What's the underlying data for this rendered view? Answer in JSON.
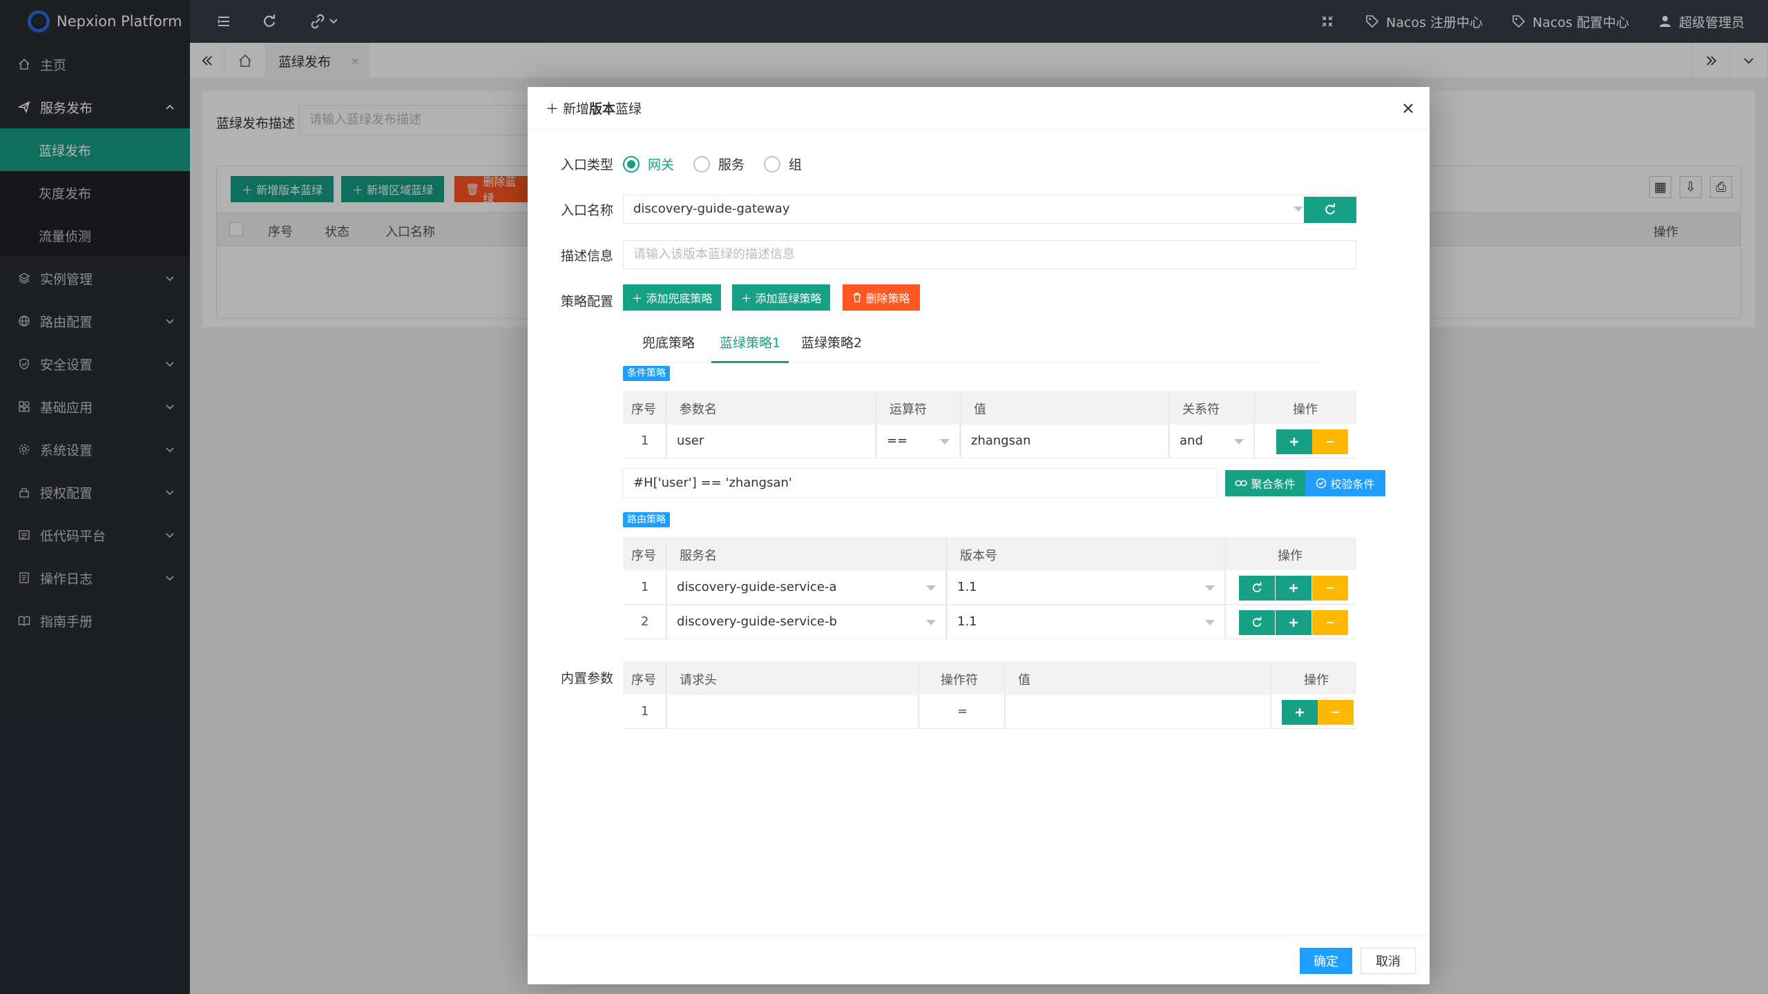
{
  "app": {
    "title": "Nepxion Platform"
  },
  "sidebar": {
    "items": [
      {
        "label": "主页",
        "icon": "home-icon"
      },
      {
        "label": "服务发布",
        "icon": "send-icon",
        "expanded": true,
        "children": [
          {
            "label": "蓝绿发布",
            "active": true
          },
          {
            "label": "灰度发布"
          },
          {
            "label": "流量侦测"
          }
        ]
      },
      {
        "label": "实例管理",
        "icon": "layers-icon"
      },
      {
        "label": "路由配置",
        "icon": "globe-icon"
      },
      {
        "label": "安全设置",
        "icon": "shield-icon"
      },
      {
        "label": "基础应用",
        "icon": "apps-icon"
      },
      {
        "label": "系统设置",
        "icon": "gear-icon"
      },
      {
        "label": "授权配置",
        "icon": "lock-icon"
      },
      {
        "label": "低代码平台",
        "icon": "code-icon"
      },
      {
        "label": "操作日志",
        "icon": "log-icon"
      },
      {
        "label": "指南手册",
        "icon": "book-icon"
      }
    ]
  },
  "topbar": {
    "nacos_registry": "Nacos 注册中心",
    "nacos_config": "Nacos 配置中心",
    "user": "超级管理员"
  },
  "tabs": {
    "active_label": "蓝绿发布",
    "close": "×"
  },
  "background": {
    "search_label": "蓝绿发布描述",
    "search_placeholder": "请输入蓝绿发布描述",
    "buttons": [
      "新增版本蓝绿",
      "新增区域蓝绿",
      "删除蓝绿"
    ],
    "columns": [
      "序号",
      "状态",
      "入口名称"
    ],
    "action_column": "操作"
  },
  "modal": {
    "title_prefix": "新增",
    "title_bold": "版本",
    "title_suffix": "蓝绿",
    "entry_type_label": "入口类型",
    "entry_types": [
      {
        "label": "网关",
        "checked": true
      },
      {
        "label": "服务",
        "checked": false
      },
      {
        "label": "组",
        "checked": false
      }
    ],
    "entry_name_label": "入口名称",
    "entry_name_value": "discovery-guide-gateway",
    "desc_label": "描述信息",
    "desc_placeholder": "请输入该版本蓝绿的描述信息",
    "strategy_label": "策略配置",
    "strategy_buttons": {
      "add_default": "添加兜底策略",
      "add_bluegreen": "添加蓝绿策略",
      "delete": "删除策略"
    },
    "strategy_tabs": [
      "兜底策略",
      "蓝绿策略1",
      "蓝绿策略2"
    ],
    "active_tab_index": 1,
    "condition": {
      "badge": "条件策略",
      "columns": [
        "序号",
        "参数名",
        "运算符",
        "值",
        "关系符",
        "操作"
      ],
      "rows": [
        {
          "index": "1",
          "param": "user",
          "operator": "==",
          "value": "zhangsan",
          "relation": "and"
        }
      ],
      "expression": "#H['user'] == 'zhangsan'",
      "aggregate_button": "聚合条件",
      "verify_button": "校验条件"
    },
    "route": {
      "badge": "路由策略",
      "columns": [
        "序号",
        "服务名",
        "版本号",
        "操作"
      ],
      "rows": [
        {
          "index": "1",
          "service": "discovery-guide-service-a",
          "version": "1.1"
        },
        {
          "index": "2",
          "service": "discovery-guide-service-b",
          "version": "1.1"
        }
      ]
    },
    "builtin": {
      "label": "内置参数",
      "columns": [
        "序号",
        "请求头",
        "操作符",
        "值",
        "操作"
      ],
      "rows": [
        {
          "index": "1",
          "header": "",
          "operator": "=",
          "value": ""
        }
      ]
    },
    "confirm": "确定",
    "cancel": "取消"
  },
  "colors": {
    "primary": "#16a085",
    "danger": "#ff5722",
    "warn": "#ffb800",
    "info": "#1e9fff",
    "sidebar": "#2b2d33",
    "topbar": "#393d49"
  }
}
